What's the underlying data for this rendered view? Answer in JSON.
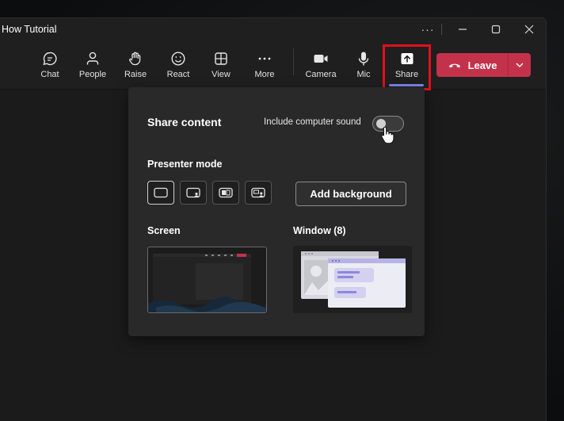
{
  "window": {
    "title": "How Tutorial",
    "controls": {
      "more": "···",
      "minimize": "—",
      "maximize": "□",
      "close": "✕"
    }
  },
  "toolbar": {
    "items": [
      {
        "label": "Chat",
        "icon": "chat-icon"
      },
      {
        "label": "People",
        "icon": "people-icon"
      },
      {
        "label": "Raise",
        "icon": "raise-hand-icon"
      },
      {
        "label": "React",
        "icon": "react-icon"
      },
      {
        "label": "View",
        "icon": "view-grid-icon"
      },
      {
        "label": "More",
        "icon": "more-icon"
      },
      {
        "label": "Camera",
        "icon": "camera-icon"
      },
      {
        "label": "Mic",
        "icon": "mic-icon"
      },
      {
        "label": "Share",
        "icon": "share-icon",
        "active": true
      }
    ],
    "leave_label": "Leave",
    "leave_color": "#c4314b",
    "highlight_color": "#e3101b",
    "active_underline_color": "#7f85f5"
  },
  "share_panel": {
    "title": "Share content",
    "include_sound_label": "Include computer sound",
    "include_sound_on": false,
    "presenter_mode_label": "Presenter mode",
    "presenter_modes": [
      "content-only-icon",
      "standout-icon",
      "side-by-side-icon",
      "reporter-icon"
    ],
    "add_background_label": "Add background",
    "screen_label": "Screen",
    "window_label": "Window (8)"
  }
}
